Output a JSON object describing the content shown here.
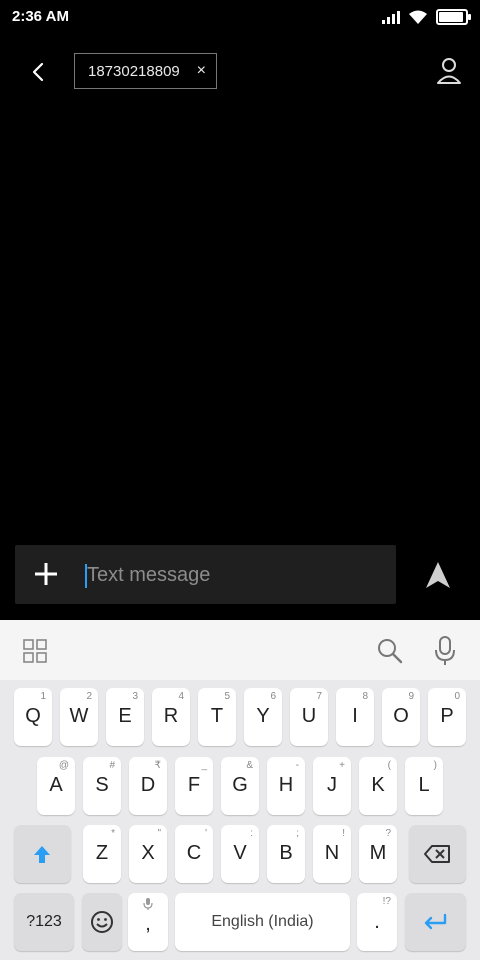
{
  "status_bar": {
    "time": "2:36 AM"
  },
  "recipient": {
    "number": "18730218809",
    "remove": "×"
  },
  "composer": {
    "placeholder": "Text message"
  },
  "keyboard": {
    "row1": [
      {
        "label": "Q",
        "hint": "1"
      },
      {
        "label": "W",
        "hint": "2"
      },
      {
        "label": "E",
        "hint": "3"
      },
      {
        "label": "R",
        "hint": "4"
      },
      {
        "label": "T",
        "hint": "5"
      },
      {
        "label": "Y",
        "hint": "6"
      },
      {
        "label": "U",
        "hint": "7"
      },
      {
        "label": "I",
        "hint": "8"
      },
      {
        "label": "O",
        "hint": "9"
      },
      {
        "label": "P",
        "hint": "0"
      }
    ],
    "row2": [
      {
        "label": "A",
        "hint": "@"
      },
      {
        "label": "S",
        "hint": "#"
      },
      {
        "label": "D",
        "hint": "₹"
      },
      {
        "label": "F",
        "hint": "_"
      },
      {
        "label": "G",
        "hint": "&"
      },
      {
        "label": "H",
        "hint": "-"
      },
      {
        "label": "J",
        "hint": "+"
      },
      {
        "label": "K",
        "hint": "("
      },
      {
        "label": "L",
        "hint": ")"
      }
    ],
    "row3": [
      {
        "label": "Z",
        "hint": "*"
      },
      {
        "label": "X",
        "hint": "\""
      },
      {
        "label": "C",
        "hint": "'"
      },
      {
        "label": "V",
        "hint": ":"
      },
      {
        "label": "B",
        "hint": ";"
      },
      {
        "label": "N",
        "hint": "!"
      },
      {
        "label": "M",
        "hint": "?"
      }
    ],
    "symbols_label": "?123",
    "comma_label": ",",
    "space_label": "English (India)",
    "period_label": ".",
    "period_hint": "!?"
  },
  "icons": {
    "back": "chevron-left-icon",
    "contact": "person-icon",
    "add": "plus-icon",
    "send": "send-icon",
    "apps": "grid-icon",
    "search": "search-icon",
    "mic": "mic-icon",
    "shift": "shift-icon",
    "backspace": "backspace-icon",
    "emoji": "emoji-icon",
    "enter": "enter-icon"
  },
  "colors": {
    "accent": "#2a9df4"
  }
}
